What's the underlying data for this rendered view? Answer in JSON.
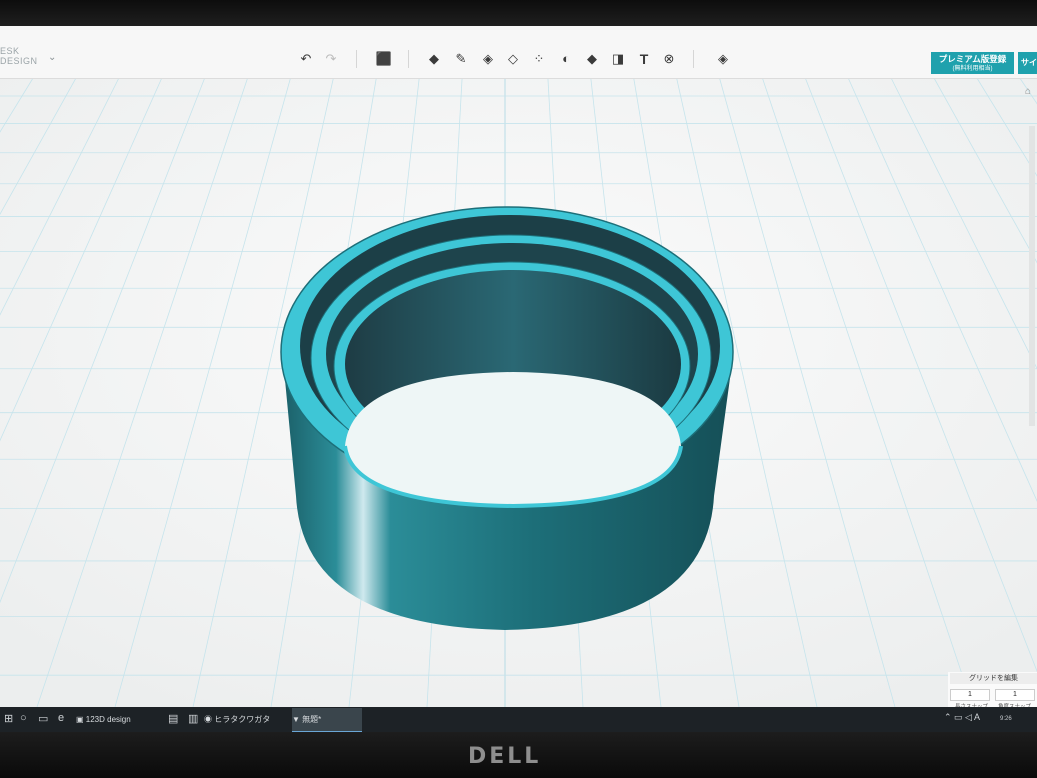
{
  "app": {
    "brand_line1": "ESK",
    "brand_line2": "DESIGN",
    "brand_chevron": "⌄"
  },
  "toolbar": {
    "undo_icon": "↶",
    "redo_icon": "↷",
    "add_shape_icon": "⬛",
    "tools": [
      "◆",
      "✎",
      "◈",
      "◇",
      "⁘",
      "◐",
      "◆",
      "◨",
      "T",
      "⊗",
      "◈"
    ],
    "premium_label": "プレミアム版登録",
    "premium_sublabel": "(無料利用相当)",
    "signin_label": "サイ"
  },
  "model": {
    "color": "#1c6e78",
    "rim_color": "#3ec6d6"
  },
  "grid_panel": {
    "edit_label": "グリッドを編集",
    "snap_value": "1",
    "rotate_value": "1",
    "snap_label": "長さスナップ",
    "rotate_label": "角度スナップ"
  },
  "taskbar": {
    "items": [
      "123D design",
      "ヒラタクワガタ（ゼロエ...",
      "無題*"
    ],
    "clock": "9:26"
  },
  "bezel": {
    "logo": "DELL"
  },
  "colors": {
    "accent": "#1fa1ad",
    "viewport_bg": "#f2f3f3",
    "grid_line": "#bfe3ee",
    "taskbar": "#1d2226"
  }
}
